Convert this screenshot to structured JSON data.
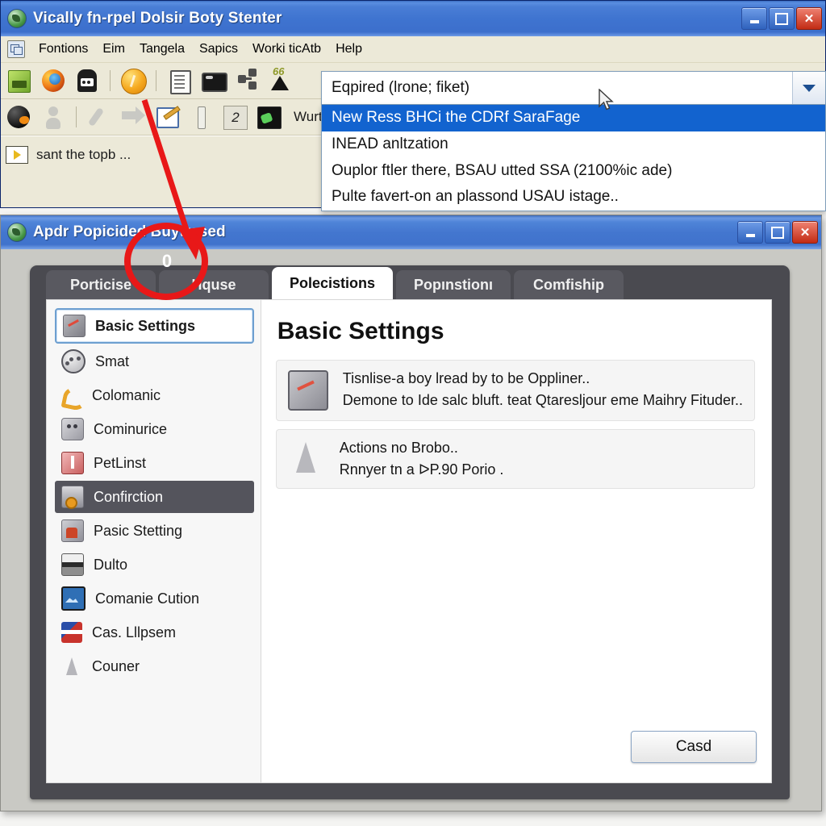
{
  "back_window": {
    "title": "Vically fn-rpel Dolsir Boty Stenter",
    "window_controls": {
      "minimize": "_",
      "maximize": "□",
      "close": "X"
    },
    "menu": [
      {
        "label": "Fontions",
        "accel": "F"
      },
      {
        "label": "Eim",
        "accel": ""
      },
      {
        "label": "Tangela",
        "accel": ""
      },
      {
        "label": "Sapics",
        "accel": ""
      },
      {
        "label": "Worki ticAtb",
        "accel": ""
      },
      {
        "label": "Help",
        "accel": "H"
      }
    ],
    "toolbar_row1_icons": [
      "green-install-icon",
      "firefox-browser-icon",
      "robot-icon",
      "orange-ball-icon",
      "document-icon",
      "screen-icon",
      "share-node-icon",
      "triangle-upload-icon"
    ],
    "toolbar_row1_badge": "66",
    "toolbar_row2_icons": [
      "black-ball-icon",
      "person-icon",
      "wrench-icon",
      "arrow-right-icon",
      "edit-pencil-icon",
      "bar-icon",
      "number-2-icon",
      "dark-green-icon"
    ],
    "toolbar_row2_text": "Wurt",
    "status_text": "sant the topb ...",
    "status_icon": "play-arrow-icon"
  },
  "combo": {
    "value": "Eqpired (lrone; fiket)",
    "arrow_icon": "chevron-down-icon",
    "options": [
      "New Ress BHCi the CDRf SaraFage",
      "INEAD anltzation",
      "Ouplor ftler there, BSAU utted SSA (2100%ic ade)",
      "Pulte favert-on an plassond USAU istage.."
    ],
    "selected_index": 0
  },
  "front_window": {
    "title": "Apdr Popicided Buytrased",
    "window_controls": {
      "minimize": "_",
      "maximize": "□",
      "close": "X"
    },
    "tabs": [
      {
        "label": "Porticise",
        "active": false
      },
      {
        "label": "Hquse",
        "active": false
      },
      {
        "label": "Polecistions",
        "active": true
      },
      {
        "label": "Popınstionı",
        "active": false
      },
      {
        "label": "Comfiship",
        "active": false
      }
    ],
    "sidebar": [
      {
        "label": "Basic Settings",
        "icon": "picture-settings-icon",
        "state": "selected"
      },
      {
        "label": "Smat",
        "icon": "ball-icon",
        "state": "normal"
      },
      {
        "label": "Colomanic",
        "icon": "phone-icon",
        "state": "normal"
      },
      {
        "label": "Cominurice",
        "icon": "face-icon",
        "state": "normal"
      },
      {
        "label": "PetLinst",
        "icon": "red-book-icon",
        "state": "normal"
      },
      {
        "label": "Confirction",
        "icon": "gear-icon",
        "state": "active"
      },
      {
        "label": "Pasic Stetting",
        "icon": "tools-icon",
        "state": "normal"
      },
      {
        "label": "Dulto",
        "icon": "printer-icon",
        "state": "normal"
      },
      {
        "label": "Comanie Cution",
        "icon": "image-icon",
        "state": "normal"
      },
      {
        "label": "Cas. Lllpsem",
        "icon": "flag-icon",
        "state": "normal"
      },
      {
        "label": "Couner",
        "icon": "cone-icon",
        "state": "normal"
      }
    ],
    "content": {
      "title": "Basic Settings",
      "cards": [
        {
          "icon": "picture-settings-icon",
          "line1": "Tisnlise-a boy lread by to be Oppliner..",
          "line2": "Demone to Ide salc bluft. teat Qtaresljour eme Maihry Fituder.."
        },
        {
          "icon": "cone-icon",
          "line1": "Actions no Brobo..",
          "line2": "Rnnyer tn a ᐅP.90 Porio ."
        }
      ],
      "button": "Casd"
    }
  },
  "annotations": {
    "badge_number": "0",
    "circle_color": "#e81818",
    "arrow_color": "#e81818"
  },
  "colors": {
    "xp_title_blue": "#4376cf",
    "xp_chrome": "#ece9d8",
    "highlight_blue": "#1263cf",
    "panel_dark": "#4a4a50",
    "tab_inactive": "#595960",
    "sidebar_active": "#54545c",
    "accent_red": "#e81818"
  }
}
